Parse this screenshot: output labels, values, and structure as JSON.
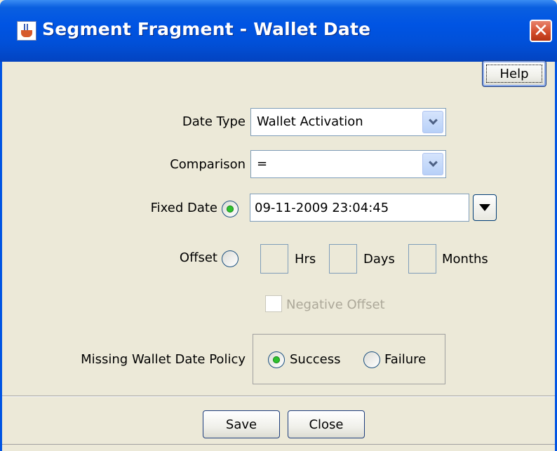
{
  "window": {
    "title": "Segment Fragment - Wallet Date",
    "close_label": "✕"
  },
  "toolbar": {
    "help_label": "Help"
  },
  "form": {
    "date_type": {
      "label": "Date Type",
      "value": "Wallet Activation"
    },
    "comparison": {
      "label": "Comparison",
      "value": "="
    },
    "fixed_date": {
      "label": "Fixed Date",
      "selected": true,
      "value": "09-11-2009 23:04:45"
    },
    "offset": {
      "label": "Offset",
      "selected": false,
      "hrs_label": "Hrs",
      "days_label": "Days",
      "months_label": "Months",
      "hrs_value": "",
      "days_value": "",
      "months_value": ""
    },
    "negative_offset": {
      "label": "Negative Offset",
      "checked": false,
      "enabled": false
    },
    "missing_policy": {
      "label": "Missing Wallet Date Policy",
      "options": [
        {
          "label": "Success",
          "selected": true
        },
        {
          "label": "Failure",
          "selected": false
        }
      ]
    }
  },
  "footer": {
    "save_label": "Save",
    "close_label": "Close"
  },
  "colors": {
    "titlebar": "#0054e3",
    "background": "#ece9d8",
    "radio_selected": "#2ec12e",
    "close_button": "#d24a28"
  },
  "icons": {
    "app_icon": "java-cup-icon",
    "combo_arrow": "chevron-down-icon",
    "date_picker": "triangle-down-icon"
  }
}
